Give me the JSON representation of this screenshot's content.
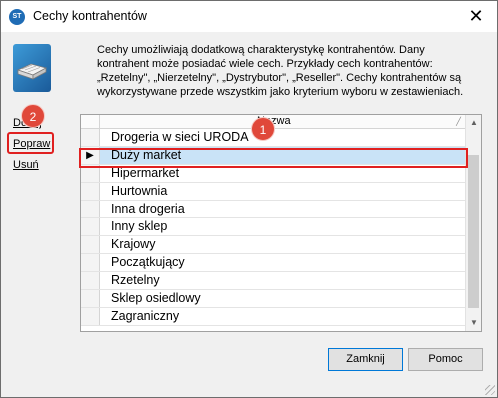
{
  "window": {
    "title": "Cechy kontrahentów",
    "app_icon_text": "ST"
  },
  "description": "Cechy umożliwiają dodatkową charakterystykę kontrahentów. Dany kontrahent może posiadać wiele cech. Przykłady cech kontrahentów: „Rzetelny\", „Nierzetelny\", „Dystrybutor\", „Reseller\". Cechy kontrahentów są wykorzystywane przede wszystkim jako kryterium wyboru w zestawieniach.",
  "side_actions": {
    "add": "Dodaj",
    "edit": "Popraw",
    "delete": "Usuń"
  },
  "annotations": {
    "badge_1": "1",
    "badge_2": "2"
  },
  "grid": {
    "column_title": "Nazwa",
    "selected_index": 1,
    "rows": [
      "Drogeria w sieci URODA",
      "Duży market",
      "Hipermarket",
      "Hurtownia",
      "Inna drogeria",
      "Inny sklep",
      "Krajowy",
      "Początkujący",
      "Rzetelny",
      "Sklep osiedlowy",
      "Zagraniczny"
    ]
  },
  "buttons": {
    "close": "Zamknij",
    "help": "Pomoc"
  },
  "colors": {
    "highlight_red": "#e02020",
    "selection_blue": "#c9e3f7",
    "badge_red": "#e0483a"
  }
}
